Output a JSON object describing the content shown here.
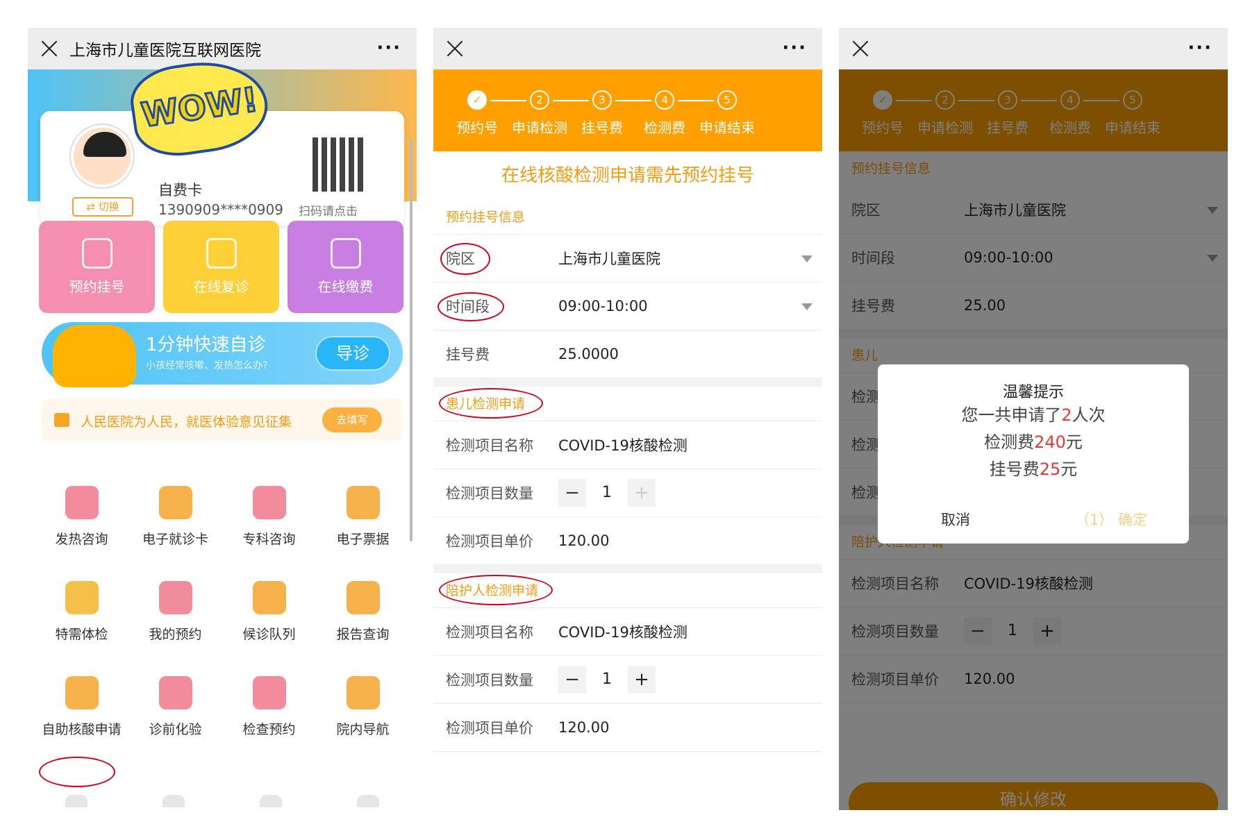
{
  "panel1": {
    "title": "上海市儿童医院互联网医院",
    "card": {
      "switch_label": "⇄ 切换",
      "type": "自费卡",
      "number": "1390909****0909",
      "qr_label": "扫码请点击",
      "sticker": "WOW!"
    },
    "tiles": [
      {
        "label": "预约挂号"
      },
      {
        "label": "在线复诊"
      },
      {
        "label": "在线缴费"
      }
    ],
    "banner": {
      "title": "1分钟快速自诊",
      "subtitle": "小孩经常咳嗽、发热怎么办?",
      "button": "导诊"
    },
    "notice": {
      "text": "人民医院为人民，就医体验意见征集",
      "button": "去填写"
    },
    "grid": [
      {
        "label": "发热咨询",
        "icon": "doctor-icon",
        "color": "#f28b9c"
      },
      {
        "label": "电子就诊卡",
        "icon": "card-icon",
        "color": "#f5b24a"
      },
      {
        "label": "专科咨询",
        "icon": "nurse-icon",
        "color": "#f28b9c"
      },
      {
        "label": "电子票据",
        "icon": "ticket-icon",
        "color": "#f5b24a"
      },
      {
        "label": "特需体检",
        "icon": "checkup-icon",
        "color": "#f5c04a"
      },
      {
        "label": "我的预约",
        "icon": "home-plus-icon",
        "color": "#f28b9c"
      },
      {
        "label": "候诊队列",
        "icon": "list-icon",
        "color": "#f5b24a"
      },
      {
        "label": "报告查询",
        "icon": "chat-icon",
        "color": "#f5b24a"
      },
      {
        "label": "自助核酸申请",
        "icon": "lungs-icon",
        "color": "#f5b24a"
      },
      {
        "label": "诊前化验",
        "icon": "flask-icon",
        "color": "#f28b9c"
      },
      {
        "label": "检查预约",
        "icon": "book-icon",
        "color": "#f28b9c"
      },
      {
        "label": "院内导航",
        "icon": "compass-icon",
        "color": "#f5b24a"
      }
    ]
  },
  "steps": [
    "预约号",
    "申请检测",
    "挂号费",
    "检测费",
    "申请结束"
  ],
  "step_numbers": [
    "2",
    "3",
    "4",
    "5"
  ],
  "panel2": {
    "headline": "在线核酸检测申请需先预约挂号",
    "section_booking": "预约挂号信息",
    "campus": {
      "label": "院区",
      "value": "上海市儿童医院"
    },
    "time": {
      "label": "时间段",
      "value": "09:00-10:00"
    },
    "fee": {
      "label": "挂号费",
      "value": "25.0000"
    },
    "section_child": "患儿检测申请",
    "section_companion": "陪护人检测申请",
    "item_name_label": "检测项目名称",
    "item_name": "COVID-19核酸检测",
    "item_qty_label": "检测项目数量",
    "qty": "1",
    "item_price_label": "检测项目单价",
    "price": "120.00"
  },
  "panel3": {
    "section_booking": "预约挂号信息",
    "fee_value": "25.00",
    "section_child_partial": "患儿",
    "hidden1": "检测",
    "hidden2": "检测",
    "hidden3": "检测",
    "confirm_button": "确认修改",
    "modal": {
      "title": "温馨提示",
      "l1a": "您一共申请了",
      "l1b": "2",
      "l1c": "人次",
      "l2a": "检测费",
      "l2b": "240",
      "l2c": "元",
      "l3a": "挂号费",
      "l3b": "25",
      "l3c": "元",
      "cancel": "取消",
      "ok": "（1） 确定"
    }
  }
}
